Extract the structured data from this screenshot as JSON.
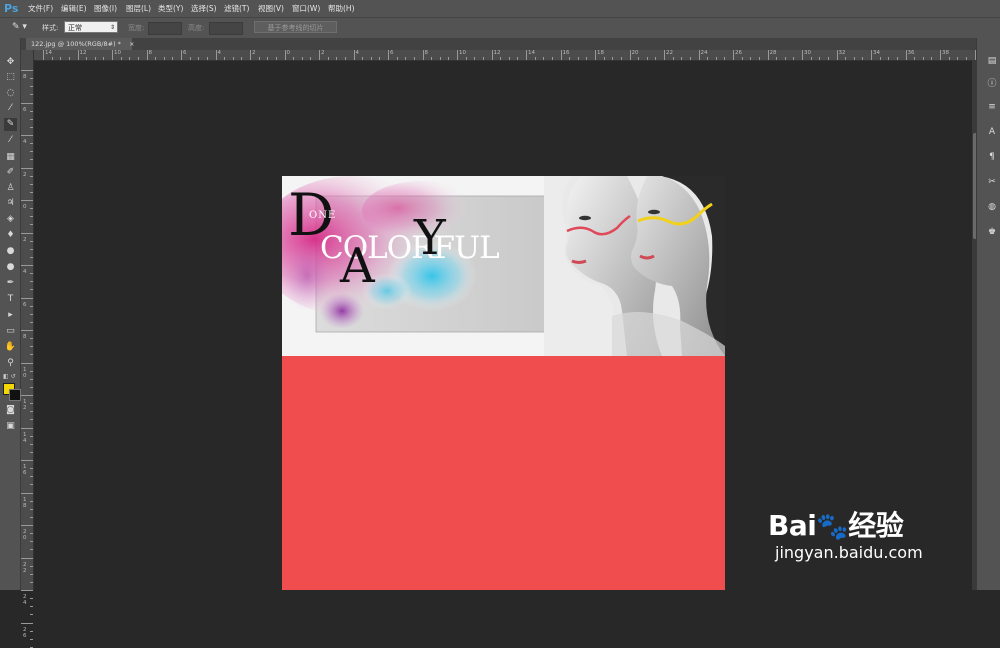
{
  "app": {
    "logo": "Ps",
    "menu": [
      "文件(F)",
      "编辑(E)",
      "图像(I)",
      "图层(L)",
      "类型(Y)",
      "选择(S)",
      "滤镜(T)",
      "视图(V)",
      "窗口(W)",
      "帮助(H)"
    ]
  },
  "options_bar": {
    "tool_icon": "slice-select-icon",
    "style_label": "样式:",
    "style_value": "正常",
    "width_label": "宽度:",
    "height_label": "高度:",
    "slice_button": "基于参考线的切片"
  },
  "document": {
    "tab_title": "122.jpg @ 100%(RGB/8#) *",
    "tab_close": "×"
  },
  "rulers": {
    "horizontal": [
      "14",
      "12",
      "10",
      "8",
      "6",
      "4",
      "2",
      "0",
      "2",
      "4",
      "6",
      "8",
      "10",
      "12",
      "14",
      "16",
      "18",
      "20",
      "22",
      "24",
      "26",
      "28",
      "30",
      "32",
      "34",
      "36",
      "38",
      "40"
    ],
    "vertical": [
      "8",
      "6",
      "4",
      "2",
      "0",
      "2",
      "4",
      "6",
      "8",
      "1 0",
      "1 2",
      "1 4",
      "1 6",
      "1 8",
      "2 0",
      "2 2",
      "2 4",
      "2 6"
    ]
  },
  "banner": {
    "letter_d": "D",
    "small_text": "ONE",
    "colorful": "COLORFUL",
    "letter_a": "A",
    "letter_y": "Y"
  },
  "colors": {
    "foreground": "#f5d600",
    "background": "#111111",
    "canvas_fill": "#f04e4e"
  },
  "watermark": {
    "brand": "Bai",
    "brand_suffix": "经验",
    "url": "jingyan.baidu.com"
  }
}
